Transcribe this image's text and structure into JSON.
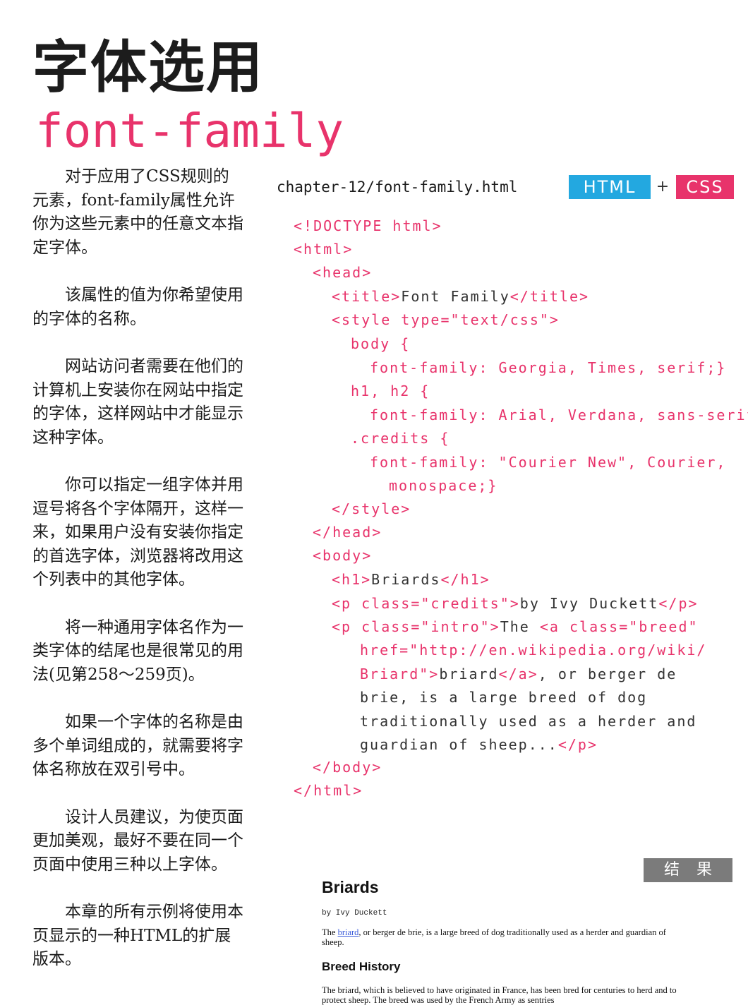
{
  "heading": {
    "title_zh": "字体选用",
    "title_en": "font-family"
  },
  "left_paragraphs": [
    "对于应用了CSS规则的元素，font-family属性允许你为这些元素中的任意文本指定字体。",
    "该属性的值为你希望使用的字体的名称。",
    "网站访问者需要在他们的计算机上安装你在网站中指定的字体，这样网站中才能显示这种字体。",
    "你可以指定一组字体并用逗号将各个字体隔开，这样一来，如果用户没有安装你指定的首选字体，浏览器将改用这个列表中的其他字体。",
    "将一种通用字体名作为一类字体的结尾也是很常见的用法(见第258～259页)。",
    "如果一个字体的名称是由多个单词组成的，就需要将字体名称放在双引号中。",
    "设计人员建议，为使页面更加美观，最好不要在同一个页面中使用三种以上字体。",
    "本章的所有示例将使用本页显示的一种HTML的扩展版本。"
  ],
  "example": {
    "filename": "chapter-12/font-family.html",
    "badge_html": "HTML",
    "badge_plus": "+",
    "badge_css": "CSS",
    "code_lines": [
      [
        {
          "t": "<!DOCTYPE html>",
          "c": "pink"
        }
      ],
      [
        {
          "t": "<html>",
          "c": "pink"
        }
      ],
      [
        {
          "t": "<head>",
          "c": "pink"
        }
      ],
      [
        {
          "t": "<title>",
          "c": "pink"
        },
        {
          "t": "Font Family",
          "c": "dark"
        },
        {
          "t": "</title>",
          "c": "pink"
        }
      ],
      [
        {
          "t": "<style type=\"text/css\">",
          "c": "pink"
        }
      ],
      [
        {
          "t": "body {",
          "c": "pink"
        }
      ],
      [
        {
          "t": "font-family: Georgia, Times, serif;}",
          "c": "pink"
        }
      ],
      [
        {
          "t": "h1, h2 {",
          "c": "pink"
        }
      ],
      [
        {
          "t": "font-family: Arial, Verdana, sans-serif;}",
          "c": "pink"
        }
      ],
      [
        {
          "t": ".credits {",
          "c": "pink"
        }
      ],
      [
        {
          "t": "font-family: \"Courier New\", Courier,",
          "c": "pink"
        }
      ],
      [
        {
          "t": "monospace;}",
          "c": "pink"
        }
      ],
      [
        {
          "t": "</style>",
          "c": "pink"
        }
      ],
      [
        {
          "t": "</head>",
          "c": "pink"
        }
      ],
      [
        {
          "t": "<body>",
          "c": "pink"
        }
      ],
      [
        {
          "t": "<h1>",
          "c": "pink"
        },
        {
          "t": "Briards",
          "c": "dark"
        },
        {
          "t": "</h1>",
          "c": "pink"
        }
      ],
      [
        {
          "t": "<p class=\"credits\">",
          "c": "pink"
        },
        {
          "t": "by Ivy Duckett",
          "c": "dark"
        },
        {
          "t": "</p>",
          "c": "pink"
        }
      ],
      [
        {
          "t": "<p class=\"intro\">",
          "c": "pink"
        },
        {
          "t": "The ",
          "c": "dark"
        },
        {
          "t": "<a class=\"breed\"",
          "c": "pink"
        }
      ],
      [
        {
          "t": "href=\"http://en.wikipedia.org/wiki/",
          "c": "pink"
        }
      ],
      [
        {
          "t": "Briard\">",
          "c": "pink"
        },
        {
          "t": "briard",
          "c": "dark"
        },
        {
          "t": "</a>",
          "c": "pink"
        },
        {
          "t": ", or berger de",
          "c": "dark"
        }
      ],
      [
        {
          "t": "brie, is a large breed of dog",
          "c": "dark"
        }
      ],
      [
        {
          "t": "traditionally used as a herder and",
          "c": "dark"
        }
      ],
      [
        {
          "t": "guardian of sheep...",
          "c": "dark"
        },
        {
          "t": "</p>",
          "c": "pink"
        }
      ],
      [
        {
          "t": "</body>",
          "c": "pink"
        }
      ],
      [
        {
          "t": "</html>",
          "c": "pink"
        }
      ]
    ]
  },
  "result": {
    "badge": "结果",
    "h1": "Briards",
    "credits": "by Ivy Duckett",
    "intro_before": "The ",
    "intro_link": "briard",
    "intro_after": ", or berger de brie, is a large breed of dog traditionally used as a herder and guardian of sheep.",
    "h2": "Breed History",
    "history": "The briard, which is believed to have originated in France, has been bred for centuries to herd and to protect sheep. The breed was used by the French Army as sentries"
  }
}
